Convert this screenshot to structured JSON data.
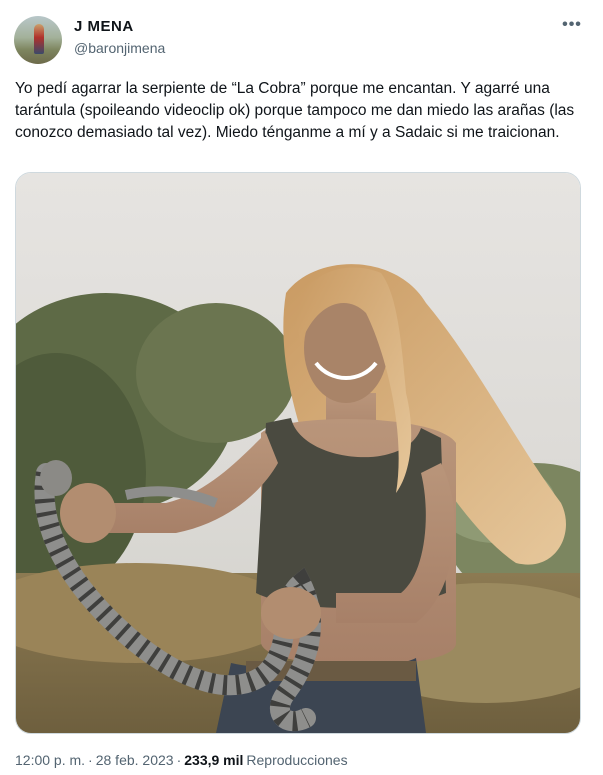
{
  "author": {
    "display_name": "J MENA",
    "handle": "@baronjimena"
  },
  "menu_icon": "more-horizontal-icon",
  "tweet": {
    "text": "Yo pedí agarrar la serpiente de “La Cobra” porque me encantan. Y agarré una tarántula (spoileando videoclip ok) porque tampoco me dan miedo las arañas (las conozco demasiado tal vez). Miedo ténganme a mí y a Sadaic si me traicionan."
  },
  "meta": {
    "time": "12:00 p. m.",
    "separator": "·",
    "date": "28 feb. 2023",
    "views_count": "233,9 mil",
    "views_label": "Reproducciones"
  },
  "colors": {
    "text_primary": "#0f1419",
    "text_secondary": "#536471",
    "border": "#cfd9de"
  }
}
